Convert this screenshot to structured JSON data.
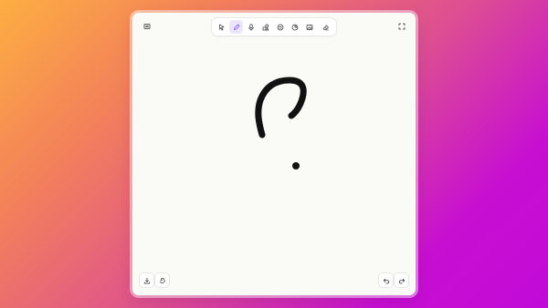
{
  "canvas": {
    "ink_color": "#111111",
    "background": "#fafaf7",
    "strokes": [
      "question-mark-hook",
      "question-mark-dot"
    ]
  },
  "menu": {
    "icon": "hamburger-menu-icon"
  },
  "toolbar": {
    "tools": [
      {
        "name": "select",
        "icon": "cursor-icon",
        "active": false
      },
      {
        "name": "pen",
        "icon": "pencil-icon",
        "active": true
      },
      {
        "name": "microphone",
        "icon": "microphone-icon",
        "active": false
      },
      {
        "name": "shapes",
        "icon": "shapes-icon",
        "active": false
      },
      {
        "name": "emoji",
        "icon": "smiley-icon",
        "active": false
      },
      {
        "name": "sticker",
        "icon": "sticker-icon",
        "active": false
      },
      {
        "name": "image",
        "icon": "image-icon",
        "active": false
      },
      {
        "name": "eraser",
        "icon": "eraser-icon",
        "active": false
      }
    ],
    "accent_color": "#7c4dff"
  },
  "fullscreen": {
    "icon": "expand-icon"
  },
  "bottom_left": {
    "icons": [
      "download-icon",
      "recycle-icon"
    ]
  },
  "bottom_right": {
    "icons": [
      "undo-icon",
      "redo-icon"
    ]
  }
}
